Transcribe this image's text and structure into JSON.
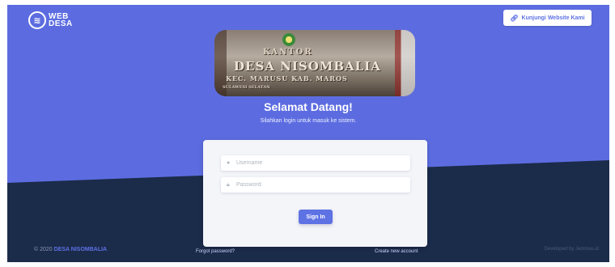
{
  "header": {
    "logo_mark": "≋",
    "logo_line1": "WEB",
    "logo_line2": "DESA",
    "visit_icon": "link-icon",
    "visit_label": "Kunjungi Website Kami"
  },
  "hero": {
    "photo_lines": [
      "KANTOR",
      "DESA NISOMBALIA",
      "KEC. MARUSU  KAB. MAROS",
      "SULAWESI SELATAN"
    ],
    "title": "Selamat Datang!",
    "subtitle": "Silahkan login untuk masuk ke sistem."
  },
  "login": {
    "username_placeholder": "Username",
    "password_placeholder": "Password",
    "username_icon": "user-icon",
    "password_icon": "lock-icon",
    "signin_label": "Sign In"
  },
  "links": {
    "forgot": "Forgot password?",
    "create": "Create new account"
  },
  "footer": {
    "copyright": "© 2020",
    "brand": "DESA NISOMBALIA",
    "developed": "Developed by Jemmas.id"
  },
  "colors": {
    "primary": "#5e72e4",
    "dark": "#1b2b4a"
  }
}
